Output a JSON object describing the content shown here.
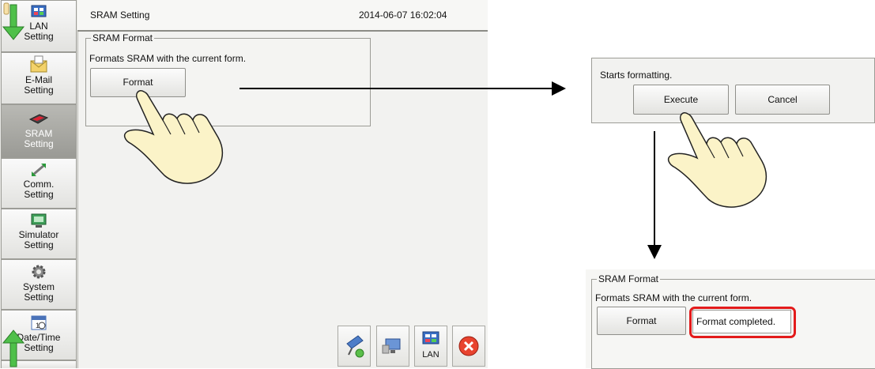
{
  "sidebar": {
    "items": [
      {
        "label_1": "LAN",
        "label_2": "Setting",
        "icon": "lan-setting-icon"
      },
      {
        "label_1": "E-Mail",
        "label_2": "Setting",
        "icon": "email-icon"
      },
      {
        "label_1": "SRAM",
        "label_2": "Setting",
        "icon": "sram-icon",
        "active": true
      },
      {
        "label_1": "Comm.",
        "label_2": "Setting",
        "icon": "comm-icon"
      },
      {
        "label_1": "Simulator",
        "label_2": "Setting",
        "icon": "simulator-icon"
      },
      {
        "label_1": "System",
        "label_2": "Setting",
        "icon": "gear-icon"
      },
      {
        "label_1": "Date/Time",
        "label_2": "Setting",
        "icon": "calendar-icon"
      }
    ]
  },
  "header": {
    "title": "SRAM Setting",
    "datetime": "2014-06-07 16:02:04"
  },
  "sram_format": {
    "legend": "SRAM Format",
    "description": "Formats SRAM with the current form.",
    "format_label": "Format"
  },
  "taskbar": {
    "lan_label": "LAN"
  },
  "confirm_dialog": {
    "message": "Starts formatting.",
    "execute_label": "Execute",
    "cancel_label": "Cancel"
  },
  "result": {
    "legend": "SRAM Format",
    "description": "Formats SRAM with the current form.",
    "format_label": "Format",
    "status": "Format completed."
  },
  "colors": {
    "highlight": "#e31b1b",
    "sidebar_active": "#a8a8a3",
    "hand": "#fbf3c8"
  }
}
